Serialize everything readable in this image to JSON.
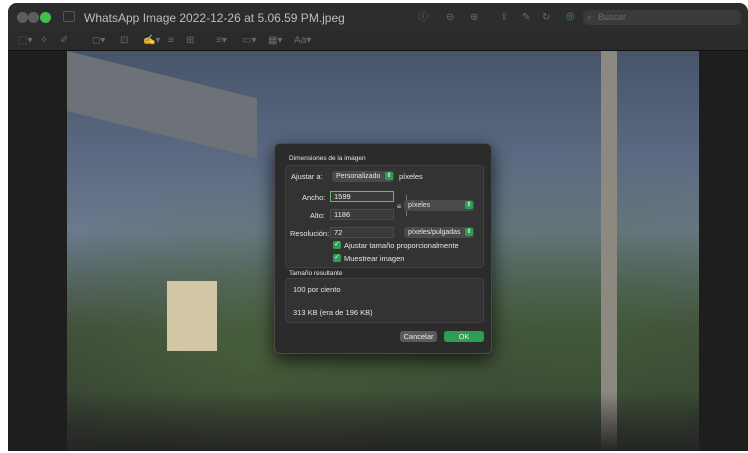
{
  "window": {
    "title": "WhatsApp Image 2022-12-26 at 5.06.59 PM.jpeg",
    "search_placeholder": "Buscar"
  },
  "toolbar": {
    "markup_label": "Aa"
  },
  "dialog": {
    "section_dimensions": "Dimensiones de la imagen",
    "fit_label": "Ajustar a:",
    "fit_value": "Personalizado",
    "fit_unit": "píxeles",
    "width_label": "Ancho:",
    "width_value": "1599",
    "height_label": "Alto:",
    "height_value": "1186",
    "resolution_label": "Resolución:",
    "resolution_value": "72",
    "size_unit": "píxeles",
    "resolution_unit": "píxeles/pulgadas",
    "scale_proportionally": "Ajustar tamaño proporcionalmente",
    "resample": "Muestrear imagen",
    "section_result": "Tamaño resultante",
    "result_percent": "100 por ciento",
    "result_size": "313 KB (era de 196 KB)",
    "cancel": "Cancelar",
    "ok": "OK"
  },
  "colors": {
    "accent": "#2f9e55",
    "window_bg": "#1e1e1e",
    "dialog_bg": "#2b2b2b"
  }
}
